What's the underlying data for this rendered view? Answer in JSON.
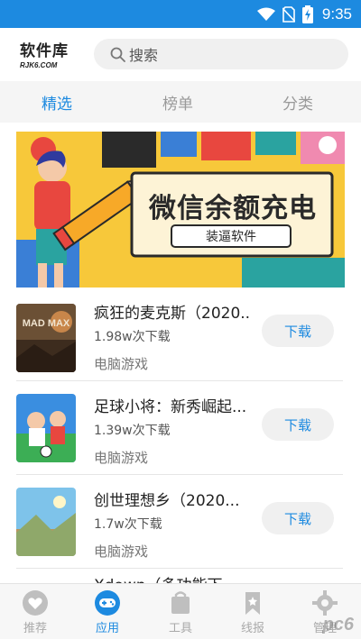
{
  "status_bar": {
    "time": "9:35",
    "icons": [
      "wifi-icon",
      "no-sim-icon",
      "battery-charging-icon"
    ],
    "bg_color": "#1d8ae0"
  },
  "header": {
    "logo_main": "软件库",
    "logo_sub": "RJK6.COM",
    "search_placeholder": "搜索"
  },
  "tabs": [
    {
      "label": "精选",
      "active": true
    },
    {
      "label": "榜单",
      "active": false
    },
    {
      "label": "分类",
      "active": false
    }
  ],
  "banner": {
    "headline": "微信余额充电",
    "button_label": "装逼软件"
  },
  "apps": [
    {
      "title": "疯狂的麦克斯（2020...",
      "downloads": "1.98w次下载",
      "category": "电脑游戏",
      "button": "下载",
      "thumb_text": "MAD MAX"
    },
    {
      "title": "足球小将：新秀崛起...",
      "downloads": "1.39w次下载",
      "category": "电脑游戏",
      "button": "下载",
      "thumb_text": ""
    },
    {
      "title": "创世理想乡（2020...",
      "downloads": "1.7w次下载",
      "category": "电脑游戏",
      "button": "下载",
      "thumb_text": ""
    },
    {
      "title": "Xdown（多功能下...",
      "downloads": "",
      "category": "",
      "button": "",
      "thumb_text": ""
    }
  ],
  "bottom_nav": [
    {
      "label": "推荐",
      "icon": "heart-icon",
      "active": false
    },
    {
      "label": "应用",
      "icon": "gamepad-icon",
      "active": true
    },
    {
      "label": "工具",
      "icon": "bag-icon",
      "active": false
    },
    {
      "label": "线报",
      "icon": "bookmark-icon",
      "active": false
    },
    {
      "label": "管理",
      "icon": "gear-icon",
      "active": false
    }
  ],
  "watermark": "pc6",
  "colors": {
    "accent": "#1d8ae0",
    "banner_yellow": "#f7c83a"
  }
}
